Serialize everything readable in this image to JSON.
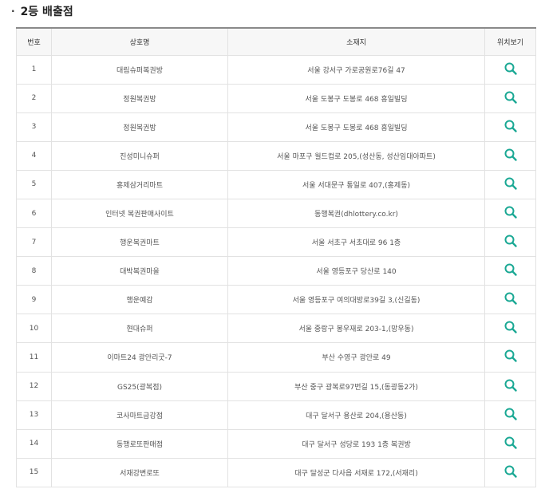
{
  "section": {
    "bullet": "·",
    "title": "2등 배출점"
  },
  "table": {
    "headers": {
      "no": "번호",
      "name": "상호명",
      "address": "소재지",
      "map": "위치보기"
    },
    "rows": [
      {
        "no": "1",
        "name": "대림슈퍼복권방",
        "address": "서울 강서구 가로공원로76길 47"
      },
      {
        "no": "2",
        "name": "정원복권방",
        "address": "서울 도봉구 도봉로 468 흥일빌딩"
      },
      {
        "no": "3",
        "name": "정원복권방",
        "address": "서울 도봉구 도봉로 468 흥일빌딩"
      },
      {
        "no": "4",
        "name": "진성미니슈퍼",
        "address": "서울 마포구 월드컵로 205,(성산동, 성산임대아파트)"
      },
      {
        "no": "5",
        "name": "홍제삼거리마트",
        "address": "서울 서대문구 통일로 407,(홍제동)"
      },
      {
        "no": "6",
        "name": "인터넷 복권판매사이트",
        "address": "동행복권(dhlottery.co.kr)"
      },
      {
        "no": "7",
        "name": "행운복권마트",
        "address": "서울 서초구 서초대로 96 1층"
      },
      {
        "no": "8",
        "name": "대박복권마을",
        "address": "서울 영등포구 당산로 140"
      },
      {
        "no": "9",
        "name": "행운예감",
        "address": "서울 영등포구 여의대방로39길 3,(신길동)"
      },
      {
        "no": "10",
        "name": "현대슈퍼",
        "address": "서울 중랑구 봉우재로 203-1,(망우동)"
      },
      {
        "no": "11",
        "name": "이마트24 광안리굿-7",
        "address": "부산 수영구 광안로 49"
      },
      {
        "no": "12",
        "name": "GS25(광복점)",
        "address": "부산 중구 광복로97번길 15,(동광동2가)"
      },
      {
        "no": "13",
        "name": "코사마트금강점",
        "address": "대구 달서구 용산로 204,(용산동)"
      },
      {
        "no": "14",
        "name": "동행로또판매점",
        "address": "대구 달서구 성당로 193 1층 복권방"
      },
      {
        "no": "15",
        "name": "서재강변로또",
        "address": "대구 달성군 다사읍 서재로 172,(서재리)"
      }
    ]
  },
  "icons": {
    "map": "search-icon"
  },
  "colors": {
    "icon": "#1aa894",
    "header_bg": "#f7f7f7",
    "top_border": "#8a8a8a"
  }
}
